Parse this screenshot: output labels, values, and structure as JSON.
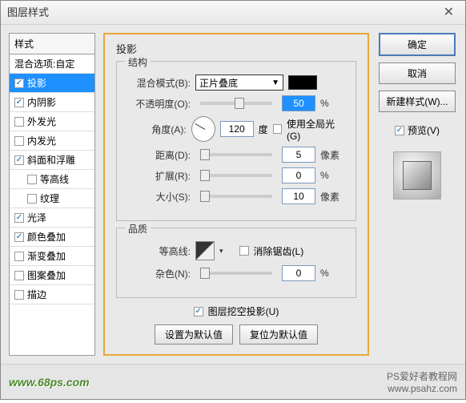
{
  "title": "图层样式",
  "left": {
    "header": "样式",
    "blend": "混合选项:自定",
    "items": [
      {
        "label": "投影",
        "checked": true,
        "selected": true
      },
      {
        "label": "内阴影",
        "checked": true
      },
      {
        "label": "外发光",
        "checked": false
      },
      {
        "label": "内发光",
        "checked": false
      },
      {
        "label": "斜面和浮雕",
        "checked": true
      },
      {
        "label": "等高线",
        "checked": false,
        "sub": true
      },
      {
        "label": "纹理",
        "checked": false,
        "sub": true
      },
      {
        "label": "光泽",
        "checked": true
      },
      {
        "label": "颜色叠加",
        "checked": true
      },
      {
        "label": "渐变叠加",
        "checked": false
      },
      {
        "label": "图案叠加",
        "checked": false
      },
      {
        "label": "描边",
        "checked": false
      }
    ]
  },
  "mid": {
    "section": "投影",
    "group1": "结构",
    "group2": "品质",
    "blendModeLabel": "混合模式(B):",
    "blendModeValue": "正片叠底",
    "opacityLabel": "不透明度(O):",
    "opacityValue": "50",
    "pct": "%",
    "angleLabel": "角度(A):",
    "angleValue": "120",
    "deg": "度",
    "globalLight": "使用全局光(G)",
    "distanceLabel": "距离(D):",
    "distance": "5",
    "px": "像素",
    "spreadLabel": "扩展(R):",
    "spread": "0",
    "sizeLabel": "大小(S):",
    "size": "10",
    "contourLabel": "等高线:",
    "antiAlias": "消除锯齿(L)",
    "noiseLabel": "杂色(N):",
    "noise": "0",
    "knockout": "图层挖空投影(U)",
    "setDefault": "设置为默认值",
    "resetDefault": "复位为默认值"
  },
  "right": {
    "ok": "确定",
    "cancel": "取消",
    "newStyle": "新建样式(W)...",
    "preview": "预览(V)"
  },
  "footer": {
    "watermark": "www.68ps.com",
    "credit1": "PS爱好者教程网",
    "credit2": "www.psahz.com"
  }
}
